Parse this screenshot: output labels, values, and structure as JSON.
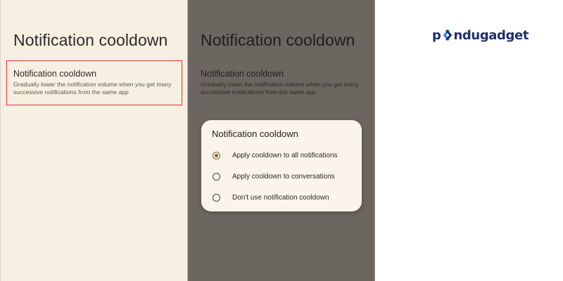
{
  "left_screen": {
    "title": "Notification cooldown",
    "setting": {
      "title": "Notification cooldown",
      "description": "Gradually lower the notification volume when you get many successive notifications from the same app"
    },
    "highlight_color": "#e0312b"
  },
  "middle_screen": {
    "title": "Notification cooldown",
    "setting": {
      "title": "Notification cooldown",
      "description": "Gradually lower the notification volume when you get many successive notifications from the same app"
    },
    "dialog": {
      "title": "Notification cooldown",
      "options": [
        {
          "label": "Apply cooldown to all notifications",
          "selected": true
        },
        {
          "label": "Apply cooldown to conversations",
          "selected": false
        },
        {
          "label": "Don't use notification cooldown",
          "selected": false
        }
      ]
    }
  },
  "logo": {
    "text_before": "p",
    "text_after": "ndugadget",
    "color": "#1f2f6e",
    "accent_color": "#2c7be5"
  }
}
